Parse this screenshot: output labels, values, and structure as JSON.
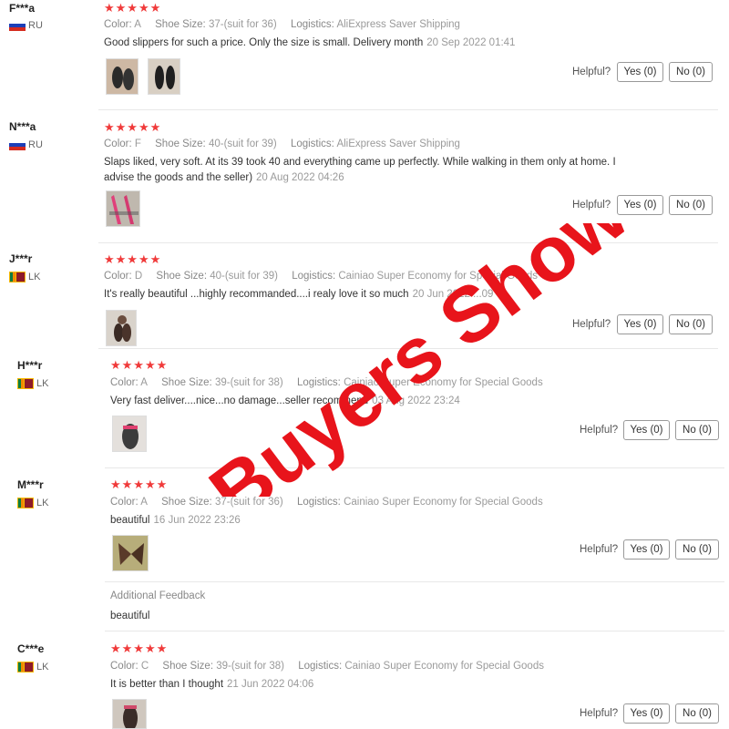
{
  "reviews": [
    {
      "user": "F***a",
      "country": "RU",
      "flag": "ru",
      "stars": "★★★★★",
      "color_label": "Color:",
      "color": "A",
      "size_label": "Shoe Size:",
      "size": "37-(suit for 36)",
      "logistics_label": "Logistics:",
      "logistics": "AliExpress Saver Shipping",
      "text": "Good slippers for such a price. Only the size is small. Delivery month",
      "date": "20 Sep 2022 01:41",
      "helpful": "Helpful?",
      "yes": "Yes (0)",
      "no": "No (0)"
    },
    {
      "user": "N***a",
      "country": "RU",
      "flag": "ru",
      "stars": "★★★★★",
      "color_label": "Color:",
      "color": "F",
      "size_label": "Shoe Size:",
      "size": "40-(suit for 39)",
      "logistics_label": "Logistics:",
      "logistics": "AliExpress Saver Shipping",
      "text": "Slaps liked, very soft. At its 39 took 40 and everything came up perfectly. While walking in them only at home. I advise the goods and the seller)",
      "date": "20 Aug 2022 04:26",
      "helpful": "Helpful?",
      "yes": "Yes (0)",
      "no": "No (0)"
    },
    {
      "user": "J***r",
      "country": "LK",
      "flag": "lk",
      "stars": "★★★★★",
      "color_label": "Color:",
      "color": "D",
      "size_label": "Shoe Size:",
      "size": "40-(suit for 39)",
      "logistics_label": "Logistics:",
      "logistics": "Cainiao Super Economy for Special Goods",
      "text": "It's really beautiful ...highly recommanded....i realy love it so much",
      "date": "20 Jun 2022 ...09",
      "helpful": "Helpful?",
      "yes": "Yes (0)",
      "no": "No (0)"
    },
    {
      "user": "H***r",
      "country": "LK",
      "flag": "lk",
      "stars": "★★★★★",
      "color_label": "Color:",
      "color": "A",
      "size_label": "Shoe Size:",
      "size": "39-(suit for 38)",
      "logistics_label": "Logistics:",
      "logistics": "Cainiao Super Economy for Special Goods",
      "text": "Very fast deliver....nice...no damage...seller recommend",
      "date": "03 Aug 2022 23:24",
      "helpful": "Helpful?",
      "yes": "Yes (0)",
      "no": "No (0)"
    },
    {
      "user": "M***r",
      "country": "LK",
      "flag": "lk",
      "stars": "★★★★★",
      "color_label": "Color:",
      "color": "A",
      "size_label": "Shoe Size:",
      "size": "37-(suit for 36)",
      "logistics_label": "Logistics:",
      "logistics": "Cainiao Super Economy for Special Goods",
      "text": "beautiful",
      "date": "16 Jun 2022 23:26",
      "helpful": "Helpful?",
      "yes": "Yes (0)",
      "no": "No (0)",
      "additional_title": "Additional Feedback",
      "additional_text": "beautiful"
    },
    {
      "user": "C***e",
      "country": "LK",
      "flag": "lk",
      "stars": "★★★★★",
      "color_label": "Color:",
      "color": "C",
      "size_label": "Shoe Size:",
      "size": "39-(suit for 38)",
      "logistics_label": "Logistics:",
      "logistics": "Cainiao Super Economy for Special Goods",
      "text": "It is better than I thought",
      "date": "21 Jun 2022 04:06",
      "helpful": "Helpful?",
      "yes": "Yes (0)",
      "no": "No (0)"
    }
  ],
  "watermark": "Buyers Show",
  "colors": {
    "star": "#f03a3a",
    "watermark": "#e8141b"
  }
}
